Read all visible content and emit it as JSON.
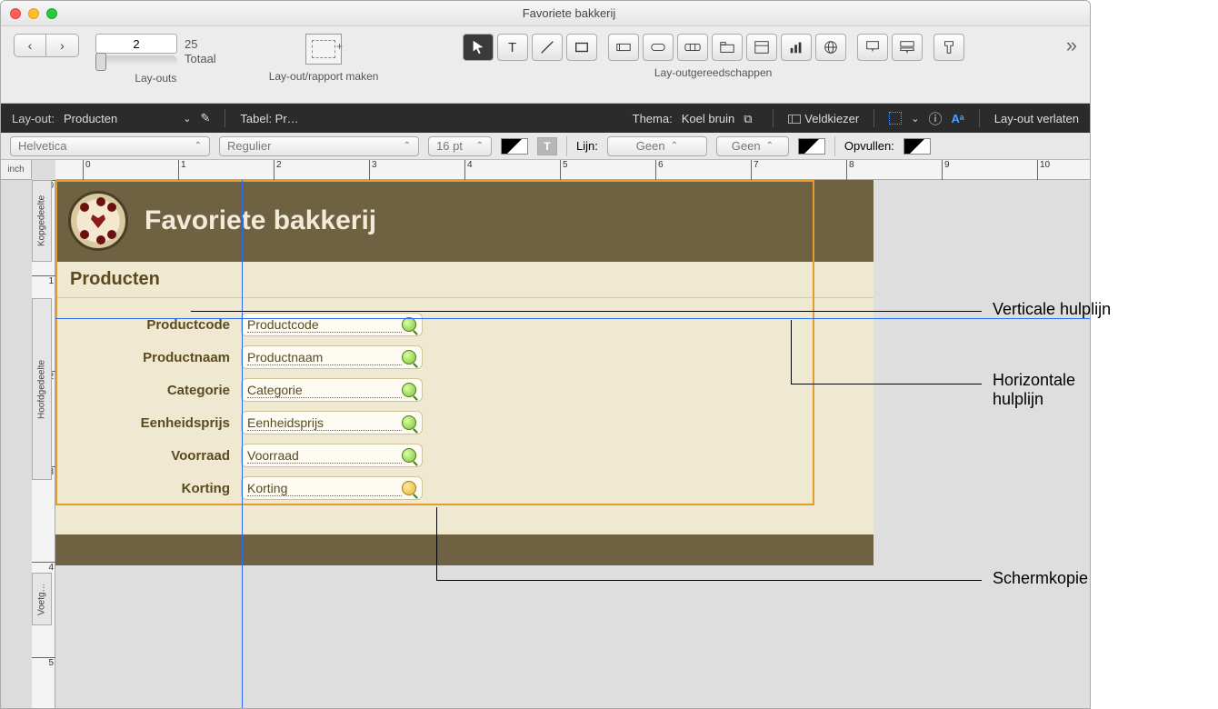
{
  "window": {
    "title": "Favoriete bakkerij"
  },
  "toolbar": {
    "layout_number": "2",
    "total_count": "25",
    "total_label": "Totaal",
    "layouts_label": "Lay-outs",
    "report_label": "Lay-out/rapport maken",
    "tools_label": "Lay-outgereedschappen"
  },
  "layoutbar": {
    "layout_label": "Lay-out:",
    "layout_name": "Producten",
    "table_label": "Tabel: Pr…",
    "theme_label": "Thema:",
    "theme_name": "Koel bruin",
    "fieldpicker": "Veldkiezer",
    "exit_layout": "Lay-out verlaten"
  },
  "formatbar": {
    "font": "Helvetica",
    "style": "Regulier",
    "size": "16 pt",
    "line_label": "Lijn:",
    "line_value": "Geen",
    "line_style": "Geen",
    "fill_label": "Opvullen:"
  },
  "ruler": {
    "unit": "inch"
  },
  "parts": {
    "header": "Kopgedeelte",
    "body": "Hoofdgedeelte",
    "footer": "Voetg…"
  },
  "layout": {
    "header_title": "Favoriete bakkerij",
    "section_title": "Producten",
    "fields": [
      {
        "label": "Productcode",
        "field": "Productcode"
      },
      {
        "label": "Productnaam",
        "field": "Productnaam"
      },
      {
        "label": "Categorie",
        "field": "Categorie"
      },
      {
        "label": "Eenheidsprijs",
        "field": "Eenheidsprijs"
      },
      {
        "label": "Voorraad",
        "field": "Voorraad"
      },
      {
        "label": "Korting",
        "field": "Korting"
      }
    ]
  },
  "callouts": {
    "vertical": "Verticale hulplijn",
    "horizontal_l1": "Horizontale",
    "horizontal_l2": "hulplijn",
    "screenshot": "Schermkopie"
  }
}
